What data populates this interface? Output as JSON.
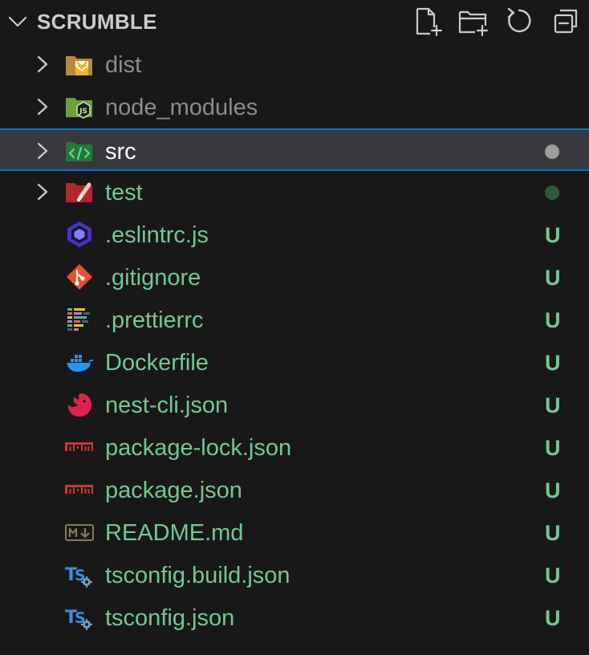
{
  "explorer": {
    "folder_title": "SCRUMBLE",
    "actions": [
      "new-file-icon",
      "new-folder-icon",
      "refresh-icon",
      "collapse-all-icon"
    ]
  },
  "colors": {
    "background": "#181818",
    "selected_background": "#37373d",
    "focus_border": "#0078d4",
    "ignored_text": "#8c8c8c",
    "untracked_text": "#73c991",
    "default_text": "#ffffff"
  },
  "tree": [
    {
      "name": "dist",
      "type": "folder",
      "icon": "folder-dist-icon",
      "status": "ignored"
    },
    {
      "name": "node_modules",
      "type": "folder",
      "icon": "folder-node-icon",
      "status": "ignored"
    },
    {
      "name": "src",
      "type": "folder",
      "icon": "folder-src-icon",
      "status": "modified-dot",
      "selected": true
    },
    {
      "name": "test",
      "type": "folder",
      "icon": "folder-test-icon",
      "status": "untracked-dot"
    },
    {
      "name": ".eslintrc.js",
      "type": "file",
      "icon": "eslint-icon",
      "badge": "U"
    },
    {
      "name": ".gitignore",
      "type": "file",
      "icon": "git-icon",
      "badge": "U"
    },
    {
      "name": ".prettierrc",
      "type": "file",
      "icon": "prettier-icon",
      "badge": "U"
    },
    {
      "name": "Dockerfile",
      "type": "file",
      "icon": "docker-icon",
      "badge": "U"
    },
    {
      "name": "nest-cli.json",
      "type": "file",
      "icon": "nestjs-icon",
      "badge": "U"
    },
    {
      "name": "package-lock.json",
      "type": "file",
      "icon": "npm-icon",
      "badge": "U"
    },
    {
      "name": "package.json",
      "type": "file",
      "icon": "npm-icon",
      "badge": "U"
    },
    {
      "name": "README.md",
      "type": "file",
      "icon": "markdown-icon",
      "badge": "U"
    },
    {
      "name": "tsconfig.build.json",
      "type": "file",
      "icon": "tsconfig-icon",
      "badge": "U"
    },
    {
      "name": "tsconfig.json",
      "type": "file",
      "icon": "tsconfig-icon",
      "badge": "U"
    }
  ]
}
